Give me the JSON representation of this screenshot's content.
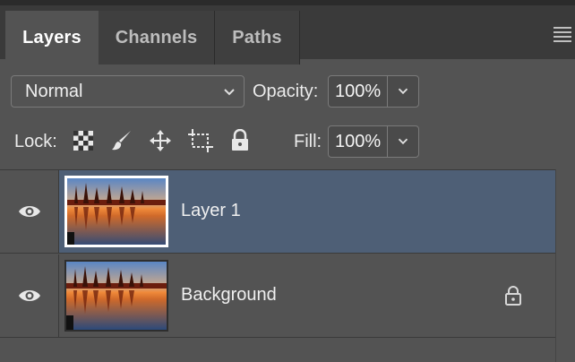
{
  "tabs": [
    {
      "label": "Layers",
      "active": true
    },
    {
      "label": "Channels",
      "active": false
    },
    {
      "label": "Paths",
      "active": false
    }
  ],
  "blend": {
    "mode": "Normal",
    "opacity_label": "Opacity:",
    "opacity_value": "100%"
  },
  "lock": {
    "label": "Lock:",
    "icons": [
      "transparency-lock-icon",
      "brush-lock-icon",
      "move-lock-icon",
      "artboard-lock-icon",
      "padlock-icon"
    ],
    "fill_label": "Fill:",
    "fill_value": "100%"
  },
  "layers": [
    {
      "name": "Layer 1",
      "visible": true,
      "selected": true,
      "locked": false
    },
    {
      "name": "Background",
      "visible": true,
      "selected": false,
      "locked": true
    }
  ],
  "colors": {
    "panel": "#535353",
    "tabbar": "#3a3a3a",
    "selected_row": "#4e5f76"
  }
}
